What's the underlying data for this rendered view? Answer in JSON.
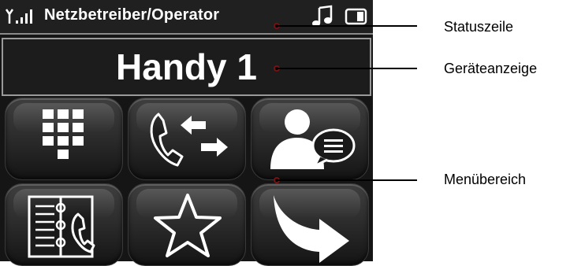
{
  "status_bar": {
    "operator": "Netzbetreiber/Operator",
    "icons": [
      "signal-strength-icon",
      "music-note-icon",
      "battery-icon"
    ]
  },
  "device_display": {
    "device_name": "Handy 1"
  },
  "menu": {
    "items": [
      {
        "icon": "dialpad-icon"
      },
      {
        "icon": "call-transfer-icon"
      },
      {
        "icon": "contact-message-icon"
      },
      {
        "icon": "phonebook-icon"
      },
      {
        "icon": "favorites-star-icon"
      },
      {
        "icon": "forward-arrow-icon"
      }
    ]
  },
  "annotations": {
    "status_bar": "Statuszeile",
    "device_display": "Geräteanzeige",
    "menu_area": "Menübereich"
  },
  "colors": {
    "screen_bg": "#151515",
    "text": "#ffffff",
    "callout_dot": "#7a1010"
  }
}
